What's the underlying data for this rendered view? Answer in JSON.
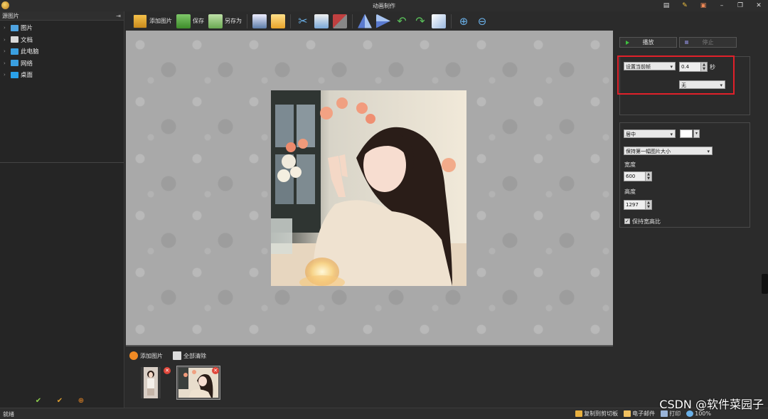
{
  "window": {
    "title": "动画制作"
  },
  "left_panel": {
    "header": "源图片",
    "pin_glyph": "⇥",
    "tree": [
      {
        "label": "图片",
        "icon": "pictures-folder-icon",
        "color": "#4fa3e0"
      },
      {
        "label": "文档",
        "icon": "documents-folder-icon",
        "color": "#d9d9d9"
      },
      {
        "label": "此电脑",
        "icon": "computer-icon",
        "color": "#3a9fe0"
      },
      {
        "label": "网络",
        "icon": "network-icon",
        "color": "#3a9fe0"
      },
      {
        "label": "桌面",
        "icon": "desktop-icon",
        "color": "#2aa0e8"
      }
    ]
  },
  "toolbar": {
    "add_image": "添加图片",
    "save": "保存",
    "save_as": "另存为"
  },
  "filmstrip": {
    "add_image": "添加图片",
    "clear_all": "全部清除",
    "delete_glyph": "✕"
  },
  "right_panel": {
    "play": "播放",
    "stop": "停止",
    "frame_mode": "设置当前帧",
    "duration": "0.4",
    "seconds_unit": "秒",
    "transition": "无",
    "align": "居中",
    "size_mode": "保持第一幅图片大小",
    "width_label": "宽度",
    "width": "600",
    "height_label": "高度",
    "height": "1297",
    "keep_ratio": "保持宽高比",
    "keep_ratio_checked": true,
    "background_color": "#ffffff"
  },
  "status": {
    "text": "就绪",
    "copy": "复制到剪切板",
    "email": "电子邮件",
    "print": "打印",
    "zoom": "100%"
  },
  "watermark": "CSDN @软件菜园子",
  "accent": {
    "highlight": "#e0202a",
    "play_green": "#3fbf3f"
  }
}
